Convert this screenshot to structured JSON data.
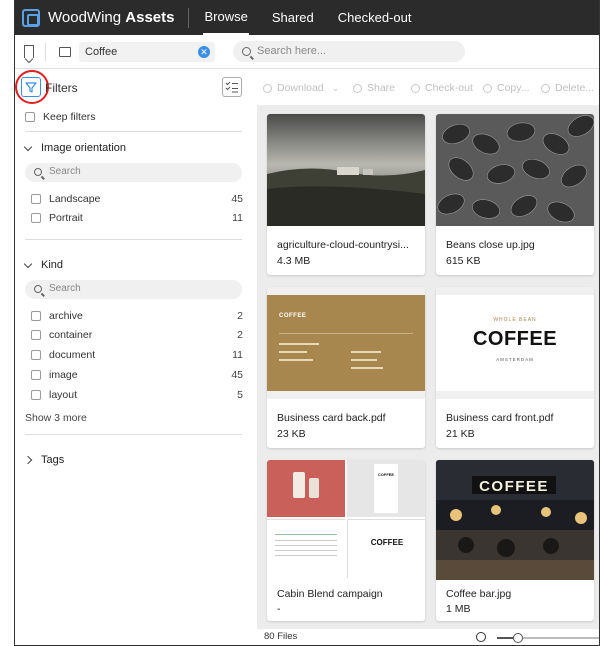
{
  "app": {
    "brand_light": "WoodWing",
    "brand_bold": "Assets"
  },
  "nav": [
    {
      "label": "Browse",
      "active": true
    },
    {
      "label": "Shared",
      "active": false
    },
    {
      "label": "Checked-out",
      "active": false
    }
  ],
  "searchbar": {
    "folder_value": "Coffee",
    "placeholder": "Search here..."
  },
  "sidebar": {
    "title": "Filters",
    "keep_filters": "Keep filters",
    "orientation": {
      "heading": "Image orientation",
      "search_placeholder": "Search",
      "items": [
        {
          "label": "Landscape",
          "count": "45"
        },
        {
          "label": "Portrait",
          "count": "11"
        }
      ]
    },
    "kind": {
      "heading": "Kind",
      "search_placeholder": "Search",
      "items": [
        {
          "label": "archive",
          "count": "2"
        },
        {
          "label": "container",
          "count": "2"
        },
        {
          "label": "document",
          "count": "11"
        },
        {
          "label": "image",
          "count": "45"
        },
        {
          "label": "layout",
          "count": "5"
        }
      ],
      "show_more": "Show 3 more"
    },
    "tags": {
      "heading": "Tags"
    }
  },
  "toolbar": {
    "download": "Download",
    "share": "Share",
    "checkout": "Check-out",
    "copy": "Copy...",
    "delete": "Delete..."
  },
  "cards": [
    {
      "name": "agriculture-cloud-countrysi...",
      "size": "4.3 MB",
      "thumb": "landscape-photo"
    },
    {
      "name": "Beans close up.jpg",
      "size": "615 KB",
      "thumb": "coffee-beans"
    },
    {
      "name": "Business card back.pdf",
      "size": "23 KB",
      "thumb": "business-card-back",
      "thumb_title": "COFFEE"
    },
    {
      "name": "Business card front.pdf",
      "size": "21 KB",
      "thumb": "business-card-front",
      "thumb_title": "COFFEE",
      "thumb_arc": "WHOLE BEAN",
      "thumb_sub": "AMSTERDAM"
    },
    {
      "name": "Cabin Blend campaign",
      "size": "-",
      "thumb": "campaign-layout",
      "thumb_title": "COFFEE"
    },
    {
      "name": "Coffee bar.jpg",
      "size": "1 MB",
      "thumb": "coffee-bar",
      "thumb_title": "COFFEE"
    }
  ],
  "status": {
    "file_count": "80 Files",
    "zoom_level": 0.2
  },
  "colors": {
    "accent": "#3a8ee6",
    "topbar": "#2b2b2b",
    "highlight_ring": "#e02020",
    "grid_bg": "#ececec"
  }
}
